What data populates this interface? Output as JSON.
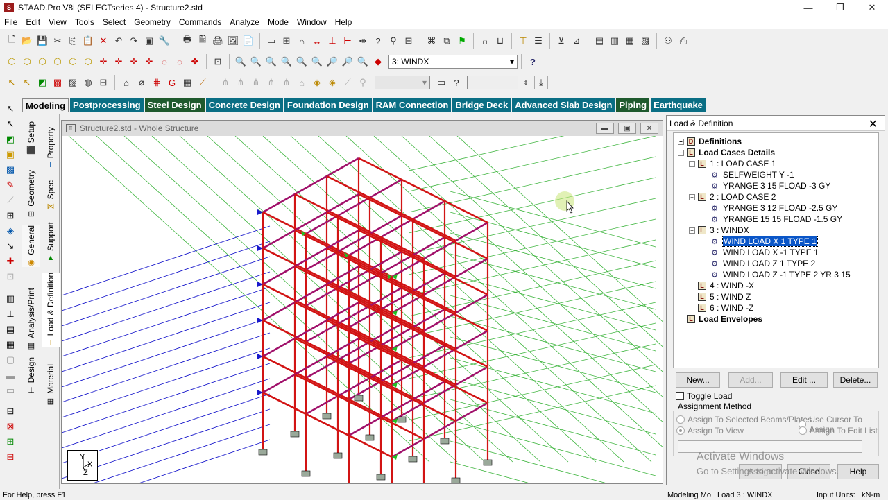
{
  "app": {
    "logo": "S",
    "title": "STAAD.Pro V8i (SELECTseries 4) - Structure2.std",
    "win_min": "—",
    "win_max": "❐",
    "win_close": "✕"
  },
  "menu": [
    "File",
    "Edit",
    "View",
    "Tools",
    "Select",
    "Geometry",
    "Commands",
    "Analyze",
    "Mode",
    "Window",
    "Help"
  ],
  "toolbar": {
    "load_combo": "3: WINDX",
    "help_icon": "?"
  },
  "tabs": [
    {
      "label": "Modeling",
      "active": true
    },
    {
      "label": "Postprocessing"
    },
    {
      "label": "Steel Design"
    },
    {
      "label": "Concrete Design"
    },
    {
      "label": "Foundation Design"
    },
    {
      "label": "RAM Connection"
    },
    {
      "label": "Bridge Deck"
    },
    {
      "label": "Advanced Slab Design"
    },
    {
      "label": "Piping"
    },
    {
      "label": "Earthquake"
    }
  ],
  "side_tabs_outer": [
    "Setup",
    "Geometry",
    "General",
    "Analysis/Print",
    "Design"
  ],
  "side_tabs_inner": [
    "Property",
    "Spec",
    "Support",
    "Load & Definition",
    "Material"
  ],
  "viewport": {
    "title": "Structure2.std - Whole Structure",
    "axis_y": "Y",
    "axis_x": "X",
    "axis_z": "Z"
  },
  "panel": {
    "title": "Load & Definition",
    "close": "✕",
    "tree": [
      {
        "label": "Definitions",
        "level": 0,
        "kind": "book",
        "letter": "D",
        "exp": "+",
        "bold": true
      },
      {
        "label": "Load Cases Details",
        "level": 0,
        "kind": "book",
        "letter": "L",
        "exp": "−",
        "bold": true
      },
      {
        "label": "1 : LOAD CASE 1",
        "level": 1,
        "kind": "book",
        "letter": "L",
        "exp": "−"
      },
      {
        "label": "SELFWEIGHT Y -1",
        "level": 2,
        "kind": "load"
      },
      {
        "label": "YRANGE 3 15 FLOAD -3 GY",
        "level": 2,
        "kind": "load"
      },
      {
        "label": "2 : LOAD CASE 2",
        "level": 1,
        "kind": "book",
        "letter": "L",
        "exp": "−"
      },
      {
        "label": "YRANGE 3 12 FLOAD -2.5 GY",
        "level": 2,
        "kind": "load"
      },
      {
        "label": "YRANGE 15 15 FLOAD -1.5 GY",
        "level": 2,
        "kind": "load"
      },
      {
        "label": "3 : WINDX",
        "level": 1,
        "kind": "book",
        "letter": "L",
        "exp": "−"
      },
      {
        "label": "WIND LOAD X 1 TYPE 1",
        "level": 2,
        "kind": "load",
        "selected": true
      },
      {
        "label": "WIND LOAD X -1 TYPE 1",
        "level": 2,
        "kind": "load"
      },
      {
        "label": "WIND LOAD Z 1 TYPE 2",
        "level": 2,
        "kind": "load"
      },
      {
        "label": "WIND LOAD Z -1 TYPE 2 YR 3 15",
        "level": 2,
        "kind": "load"
      },
      {
        "label": "4 : WIND -X",
        "level": 1,
        "kind": "book",
        "letter": "L"
      },
      {
        "label": "5 : WIND Z",
        "level": 1,
        "kind": "book",
        "letter": "L"
      },
      {
        "label": "6 : WIND -Z",
        "level": 1,
        "kind": "book",
        "letter": "L"
      },
      {
        "label": "Load Envelopes",
        "level": 0,
        "kind": "book",
        "letter": "L",
        "bold": true
      }
    ],
    "buttons": {
      "new": "New...",
      "add": "Add...",
      "edit": "Edit ...",
      "delete": "Delete..."
    },
    "toggle_load": "Toggle Load",
    "assignment_method": "Assignment Method",
    "radios": {
      "selected_beams": "Assign To Selected Beams/Plates",
      "use_cursor": "Use Cursor To Assign",
      "assign_view": "Assign To View",
      "edit_list": "Assign To Edit List"
    },
    "bottom": {
      "assign": "Assign",
      "close": "Close",
      "help": "Help"
    }
  },
  "watermark": {
    "line1": "Activate Windows",
    "line2": "Go to Settings to activate Windows."
  },
  "status": {
    "left": "For Help, press F1",
    "mode": "Modeling Mo",
    "load": "Load 3 : WINDX",
    "units_label": "Input Units:",
    "units": "kN-m"
  }
}
